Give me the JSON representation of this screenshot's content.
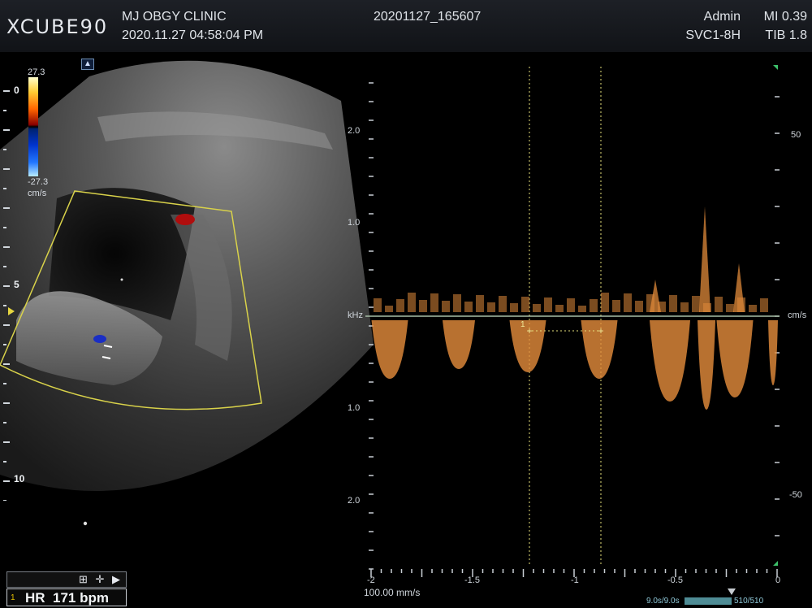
{
  "header": {
    "logo": "XCUBE90",
    "clinic": "MJ OBGY CLINIC",
    "datetime": "2020.11.27  04:58:04 PM",
    "study_id": "20201127_165607",
    "user": "Admin",
    "probe": "SVC1-8H",
    "mi": "MI 0.39",
    "tib": "TIB 1.8"
  },
  "colorbar": {
    "max": "27.3",
    "min": "-27.3",
    "unit": "cm/s"
  },
  "bmode": {
    "depth_labels": [
      "0",
      "5",
      "10"
    ]
  },
  "doppler": {
    "khz_labels_top": [
      "2.0",
      "1.0"
    ],
    "khz_labels_bottom": [
      "1.0",
      "2.0"
    ],
    "khz_unit": "kHz",
    "cms_labels": [
      "50",
      "-50"
    ],
    "cms_unit": "cm/s",
    "time_labels": [
      "-2",
      "-1.5",
      "-1",
      "-0.5",
      "0"
    ],
    "sweep_speed": "100.00 mm/s",
    "caliper_index": "1",
    "cine_left": "9.0s/9.0s",
    "cine_right": "510/510"
  },
  "measurement": {
    "index": "1",
    "label": "HR",
    "value": "171",
    "unit": "bpm",
    "tools": "⊞ ✛ ▶"
  },
  "colors": {
    "header_bg": "#16181c",
    "sector_box": "#d9d24a",
    "spectrum": "#e08a3a",
    "baseline": "#a8c0a8",
    "caliper": "#e6e07a"
  }
}
